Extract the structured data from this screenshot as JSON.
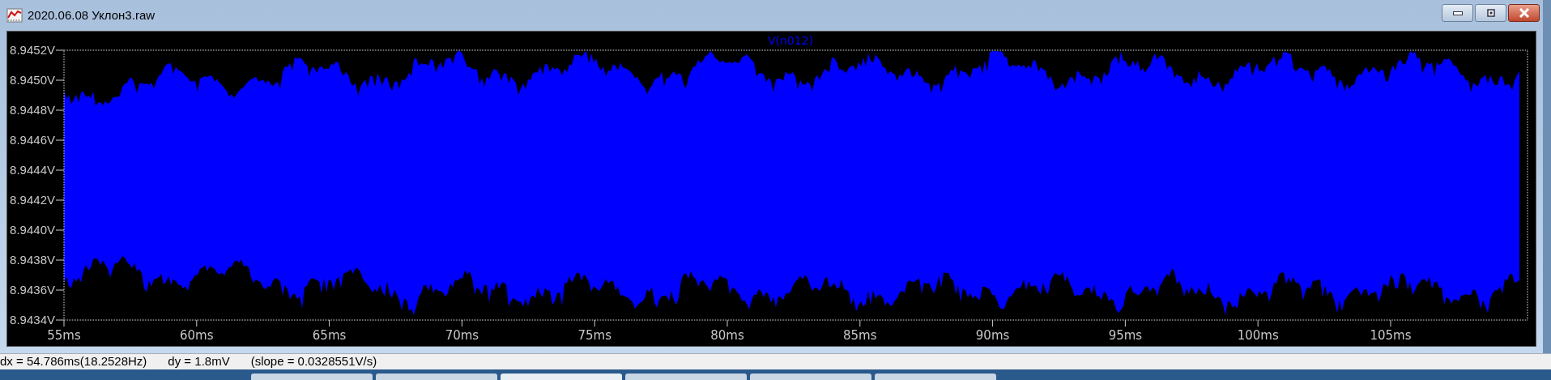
{
  "window": {
    "title": "2020.06.08 Уклон3.raw"
  },
  "plot": {
    "trace_label": "V(n012)",
    "y_ticks": [
      "8.9452V",
      "8.9450V",
      "8.9448V",
      "8.9446V",
      "8.9444V",
      "8.9442V",
      "8.9440V",
      "8.9438V",
      "8.9436V",
      "8.9434V"
    ],
    "x_ticks": [
      "55ms",
      "60ms",
      "65ms",
      "70ms",
      "75ms",
      "80ms",
      "85ms",
      "90ms",
      "95ms",
      "100ms",
      "105ms"
    ]
  },
  "status_bar": [
    "dx = 54.786ms(18.2528Hz)",
    "dy = 1.8mV",
    "(slope = 0.0328551V/s)"
  ]
}
